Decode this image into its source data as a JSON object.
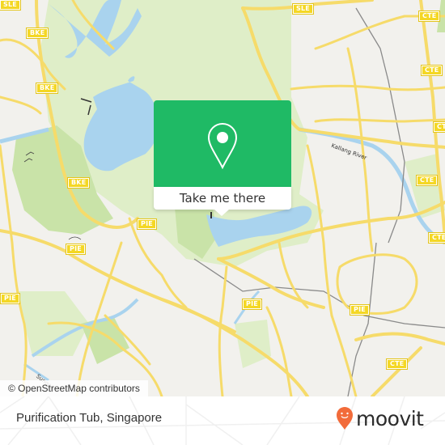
{
  "map": {
    "attribution": "© OpenStreetMap contributors",
    "colors": {
      "land": "#f2f1ed",
      "park": "#dfeec8",
      "forest": "#c9e3a8",
      "water": "#a9d3ee",
      "road": "#f6db6a",
      "shield": "#f4d724",
      "rail": "#8a8a8a"
    },
    "highway_shields": [
      {
        "label": "SLE",
        "id": "sle-1"
      },
      {
        "label": "SLE",
        "id": "sle-2"
      },
      {
        "label": "CTE",
        "id": "cte-1"
      },
      {
        "label": "CTE",
        "id": "cte-2"
      },
      {
        "label": "CTE",
        "id": "cte-3"
      },
      {
        "label": "CTE",
        "id": "cte-4"
      },
      {
        "label": "CTE",
        "id": "cte-5"
      },
      {
        "label": "CTE",
        "id": "cte-6"
      },
      {
        "label": "BKE",
        "id": "bke-1"
      },
      {
        "label": "BKE",
        "id": "bke-2"
      },
      {
        "label": "BKE",
        "id": "bke-3"
      },
      {
        "label": "PIE",
        "id": "pie-1"
      },
      {
        "label": "PIE",
        "id": "pie-2"
      },
      {
        "label": "PIE",
        "id": "pie-3"
      },
      {
        "label": "PIE",
        "id": "pie-4"
      },
      {
        "label": "PIE",
        "id": "pie-5"
      },
      {
        "label": "PIE",
        "id": "pie-6"
      }
    ],
    "labels": {
      "river": "Kallang River",
      "road": "Sungei"
    }
  },
  "popup": {
    "action_label": "Take me there",
    "pin_icon": "map-pin-icon",
    "color": "#1fba65"
  },
  "footer": {
    "place_name": "Purification Tub, Singapore",
    "brand": "moovit",
    "brand_color": "#f26b3a"
  }
}
